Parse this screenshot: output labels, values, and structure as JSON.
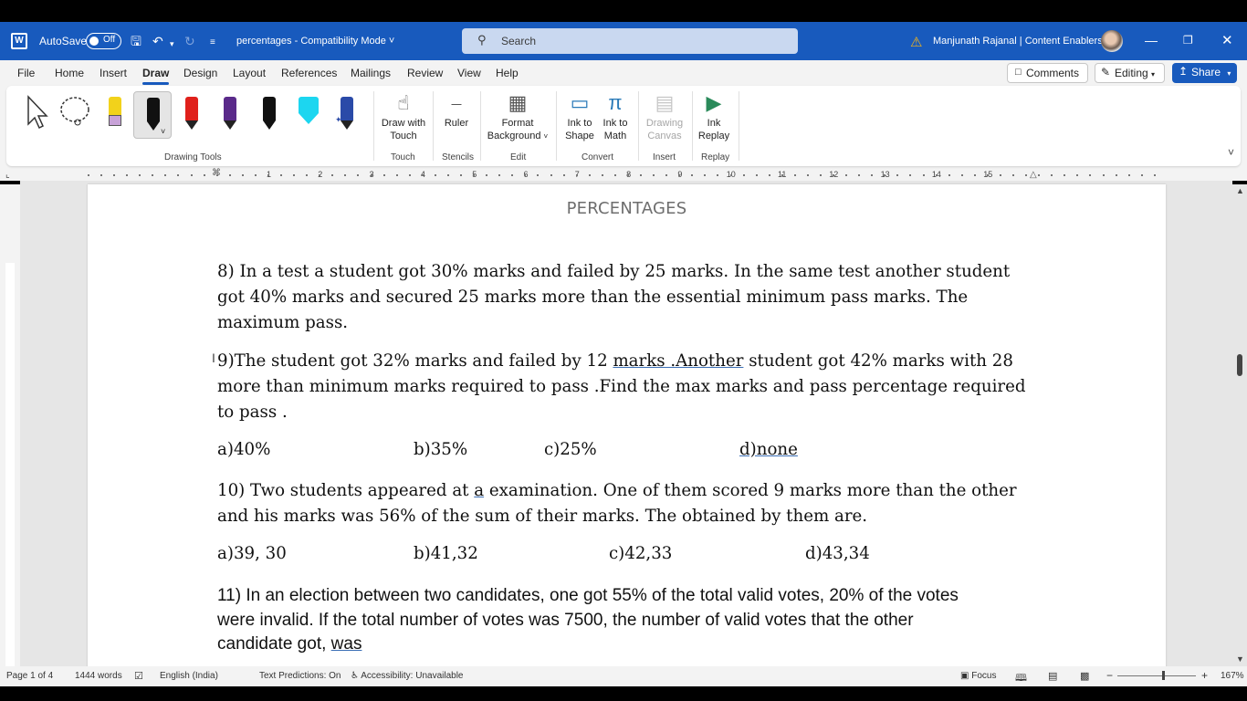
{
  "titlebar": {
    "autosave_label": "AutoSave",
    "autosave_state": "Off",
    "doc_title": "percentages  -  Compatibility Mode",
    "search_placeholder": "Search",
    "user_name": "Manjunath Rajanal | Content Enablers"
  },
  "menu": {
    "tabs": [
      "File",
      "Home",
      "Insert",
      "Draw",
      "Design",
      "Layout",
      "References",
      "Mailings",
      "Review",
      "View",
      "Help"
    ],
    "active_tab": "Draw",
    "comments_label": "Comments",
    "editing_label": "Editing",
    "share_label": "Share"
  },
  "ribbon": {
    "groups": {
      "drawing_tools": "Drawing Tools",
      "touch": "Touch",
      "stencils": "Stencils",
      "edit": "Edit",
      "convert": "Convert",
      "insert": "Insert",
      "replay": "Replay"
    },
    "buttons": {
      "draw_with_touch_1": "Draw with",
      "draw_with_touch_2": "Touch",
      "ruler": "Ruler",
      "format_bg_1": "Format",
      "format_bg_2": "Background",
      "ink_shape_1": "Ink to",
      "ink_shape_2": "Shape",
      "ink_math_1": "Ink to",
      "ink_math_2": "Math",
      "drawing_canvas_1": "Drawing",
      "drawing_canvas_2": "Canvas",
      "ink_replay_1": "Ink",
      "ink_replay_2": "Replay"
    },
    "pens": [
      {
        "color": "#f2d21b",
        "name": "highlighter-yellow"
      },
      {
        "color": "#111111",
        "name": "pen-black"
      },
      {
        "color": "#e0201b",
        "name": "pen-red"
      },
      {
        "color": "#5a2a8a",
        "name": "pen-purple"
      },
      {
        "color": "#111111",
        "name": "pen-black-pencil"
      },
      {
        "color": "#1cd6f0",
        "name": "highlighter-cyan"
      },
      {
        "color": "#2a4aa8",
        "name": "pen-galaxy-blue"
      }
    ]
  },
  "ruler": {
    "numbers": [
      "1",
      "2",
      "3",
      "4",
      "5",
      "6",
      "7",
      "8",
      "9",
      "10",
      "11",
      "12",
      "13",
      "14",
      "15"
    ]
  },
  "document": {
    "heading": "PERCENTAGES",
    "q8": {
      "line1": "8) In a test a student got 30% marks and failed by 25 marks. In the same test another student",
      "line2": "got 40% marks and secured 25 marks more than the essential minimum pass marks. The",
      "line3": "maximum pass."
    },
    "q9": {
      "line1_a": "9)The student got 32% marks and failed by 12 ",
      "line1_u": "marks .Another",
      "line1_b": " student got 42% marks with 28",
      "line2": "more than minimum marks required to pass .Find the max marks and pass percentage required",
      "line3": "to pass .",
      "options": [
        "a)40%",
        "b)35%",
        "c)25%",
        "d)none"
      ]
    },
    "q10": {
      "line1_a": "10) Two students appeared at ",
      "line1_u": "a",
      "line1_b": " examination. One of them scored 9 marks more than the other",
      "line2": "and his marks was 56% of the sum of their marks. The obtained by them are.",
      "options": [
        "a)39, 30",
        "b)41,32",
        "c)42,33",
        "d)43,34"
      ]
    },
    "q11": {
      "line1": "11) In an election between two candidates, one got 55% of the total valid votes, 20% of the votes",
      "line2": "were invalid. If the total number of votes was 7500, the number of valid votes that the other",
      "line3_a": "candidate got, ",
      "line3_u": "was"
    }
  },
  "status": {
    "page": "Page 1 of 4",
    "words": "1444 words",
    "language": "English (India)",
    "text_predictions": "Text Predictions: On",
    "accessibility": "Accessibility: Unavailable",
    "focus": "Focus",
    "zoom": "167%"
  }
}
